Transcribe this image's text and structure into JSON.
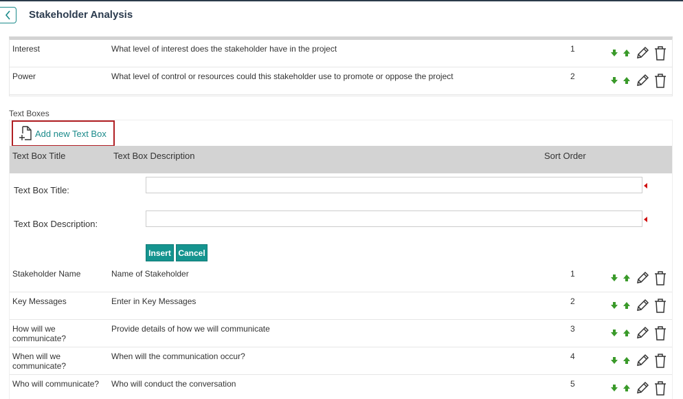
{
  "page": {
    "title": "Stakeholder Analysis"
  },
  "criteria_rows": [
    {
      "title": "Interest",
      "description": "What level of interest does the stakeholder have in the project",
      "order": "1"
    },
    {
      "title": "Power",
      "description": "What level of control or resources could this stakeholder use to promote or oppose the project",
      "order": "2"
    }
  ],
  "text_boxes": {
    "section_label": "Text Boxes",
    "add_label": "Add new Text Box",
    "columns": {
      "title": "Text Box Title",
      "description": "Text Box Description",
      "order": "Sort Order"
    },
    "form": {
      "title_label": "Text Box Title:",
      "title_value": "",
      "description_label": "Text Box Description:",
      "description_value": "",
      "insert_label": "Insert",
      "cancel_label": "Cancel"
    },
    "rows": [
      {
        "title": "Stakeholder Name",
        "description": "Name of Stakeholder",
        "order": "1"
      },
      {
        "title": "Key Messages",
        "description": "Enter in Key Messages",
        "order": "2"
      },
      {
        "title": "How will we communicate?",
        "description": "Provide details of how we will communicate",
        "order": "3"
      },
      {
        "title": "When will we communicate?",
        "description": "When will the communication occur?",
        "order": "4"
      },
      {
        "title": "Who will communicate?",
        "description": "Who will conduct the conversation",
        "order": "5"
      }
    ]
  },
  "colors": {
    "accent": "#15948f",
    "highlight_border": "#b01e23",
    "arrow_green": "#3a9a2a",
    "required": "#d01010"
  }
}
